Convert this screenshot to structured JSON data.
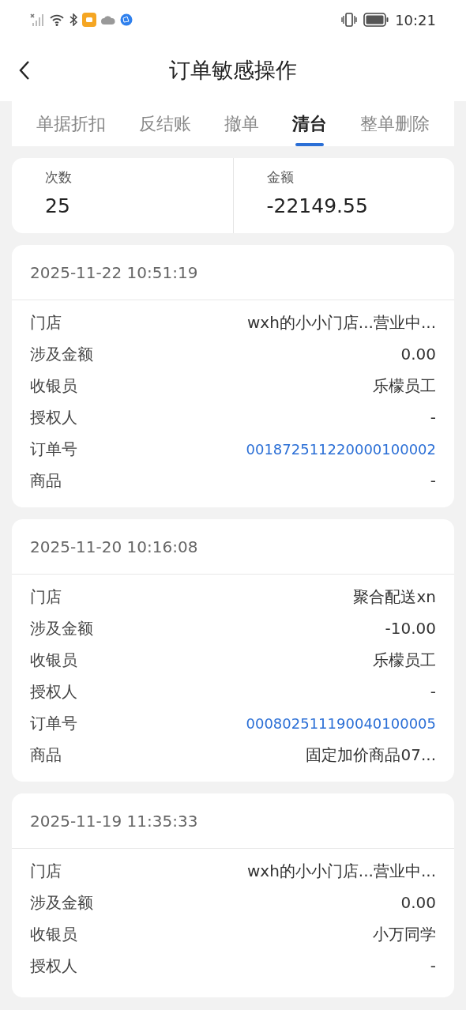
{
  "status_bar": {
    "time": "10:21"
  },
  "header": {
    "title": "订单敏感操作"
  },
  "tabs": [
    {
      "label": "单据折扣",
      "selected": false
    },
    {
      "label": "反结账",
      "selected": false
    },
    {
      "label": "撤单",
      "selected": false
    },
    {
      "label": "清台",
      "selected": true
    },
    {
      "label": "整单删除",
      "selected": false
    }
  ],
  "summary": [
    {
      "label": "次数",
      "value": "25"
    },
    {
      "label": "金额",
      "value": "-22149.55"
    }
  ],
  "records": [
    {
      "time": "2025-11-22 10:51:19",
      "fields": [
        {
          "label": "门店",
          "value": "wxh的小小门店...营业中...",
          "kind": "text"
        },
        {
          "label": "涉及金额",
          "value": "0.00",
          "kind": "text"
        },
        {
          "label": "收银员",
          "value": "乐檬员工",
          "kind": "text"
        },
        {
          "label": "授权人",
          "value": "-",
          "kind": "text"
        },
        {
          "label": "订单号",
          "value": "001872511220000100002",
          "kind": "link"
        },
        {
          "label": "商品",
          "value": "-",
          "kind": "text"
        }
      ]
    },
    {
      "time": "2025-11-20 10:16:08",
      "fields": [
        {
          "label": "门店",
          "value": "聚合配送xn",
          "kind": "text"
        },
        {
          "label": "涉及金额",
          "value": "-10.00",
          "kind": "text"
        },
        {
          "label": "收银员",
          "value": "乐檬员工",
          "kind": "text"
        },
        {
          "label": "授权人",
          "value": "-",
          "kind": "text"
        },
        {
          "label": "订单号",
          "value": "000802511190040100005",
          "kind": "link"
        },
        {
          "label": "商品",
          "value": "固定加价商品07...",
          "kind": "text"
        }
      ]
    },
    {
      "time": "2025-11-19 11:35:33",
      "fields": [
        {
          "label": "门店",
          "value": "wxh的小小门店...营业中...",
          "kind": "text"
        },
        {
          "label": "涉及金额",
          "value": "0.00",
          "kind": "text"
        },
        {
          "label": "收银员",
          "value": "小万同学",
          "kind": "text"
        },
        {
          "label": "授权人",
          "value": "-",
          "kind": "text"
        }
      ]
    }
  ]
}
